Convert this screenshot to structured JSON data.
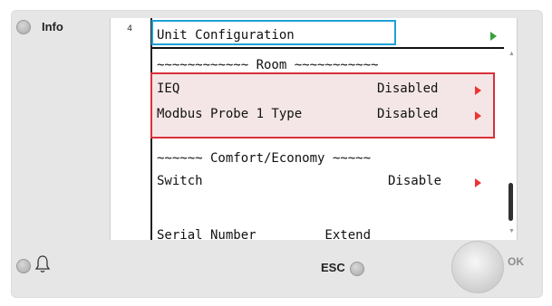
{
  "device": {
    "info_label": "Info",
    "esc_label": "ESC",
    "ok_label": "OK",
    "icons": [
      "info-led-icon",
      "bell-icon",
      "esc-led-icon"
    ]
  },
  "screen": {
    "page_number": "4",
    "title": "Unit Configuration",
    "rows": [
      {
        "label": "~~~~~~~~~~~~ Room ~~~~~~~~~~~"
      },
      {
        "label": "IEQ",
        "value": "Disabled"
      },
      {
        "label": "Modbus Probe 1 Type",
        "value": "Disabled"
      },
      {
        "label": "~~~~~~ Comfort/Economy ~~~~~"
      },
      {
        "label": "Switch",
        "value": "Disable"
      }
    ],
    "partial_row": "Serial Number         Extend"
  },
  "colors": {
    "title_highlight": "#1ea0d8",
    "selection_highlight": "#d8313b",
    "arrow_green": "#3aa03a",
    "arrow_red": "#ee3333"
  }
}
